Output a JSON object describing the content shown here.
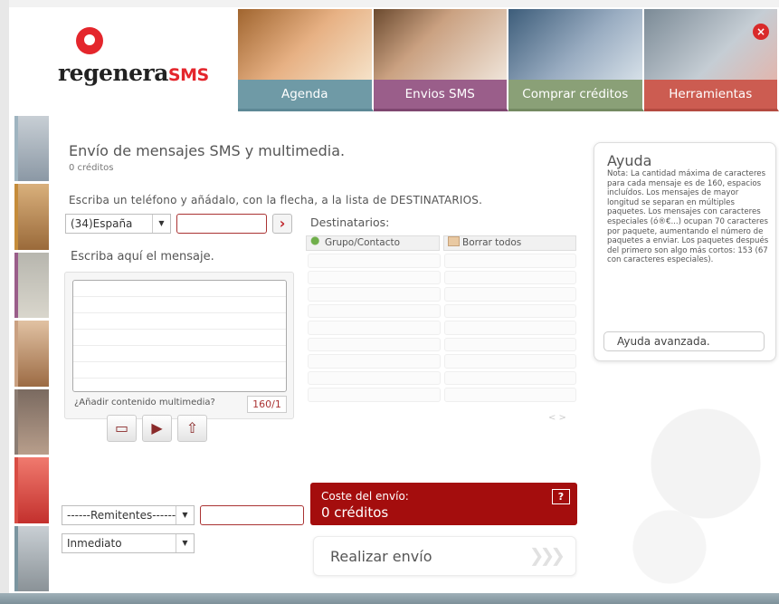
{
  "brand": {
    "logo_main": "regenera",
    "logo_accent": "SMS"
  },
  "nav": {
    "tabs": [
      {
        "label": "Agenda"
      },
      {
        "label": "Envios SMS"
      },
      {
        "label": "Comprar créditos"
      },
      {
        "label": "Herramientas"
      }
    ],
    "close_glyph": "×"
  },
  "main": {
    "title": "Envío de mensajes SMS y multimedia.",
    "credits": "0 créditos",
    "instruction": "Escriba un teléfono y añádalo, con la flecha, a la lista de DESTINATARIOS.",
    "country_select": "(34)España",
    "add_arrow": "›",
    "message_label": "Escriba aquí el mensaje.",
    "multimedia_link": "¿Añadir contenido multimedia?",
    "counter": "160/1",
    "multimedia_buttons": [
      {
        "icon": "image-icon",
        "glyph": "▭"
      },
      {
        "icon": "video-icon",
        "glyph": "▶"
      },
      {
        "icon": "upload-icon",
        "glyph": "⇧"
      }
    ]
  },
  "recipients": {
    "label": "Destinatarios:",
    "add_contact": "Grupo/Contacto",
    "clear_all": "Borrar todos",
    "rows": 9,
    "pager": "< >"
  },
  "send_options": {
    "sender_select": "------Remitentes------",
    "timing_select": "Inmediato"
  },
  "cost": {
    "label": "Coste del envío:",
    "value": "0 créditos",
    "help": "?"
  },
  "send_button": {
    "label": "Realizar envío",
    "arrows": "❯❯❯"
  },
  "help": {
    "title": "Ayuda",
    "text": "Nota: La cantidad máxima de caracteres para cada mensaje es de 160, espacios incluídos. Los mensajes de mayor longitud se separan en múltiples paquetes. Los mensajes con caracteres especiales (ó®€...) ocupan 70 caracteres por paquete, aumentando el número de paquetes a enviar. Los paquetes después del primero son algo más cortos: 153 (67 con caracteres especiales).",
    "advanced": "Ayuda avanzada."
  },
  "colors": {
    "brand_red": "#e4262c",
    "cost_red": "#a40d0d",
    "tab_agenda": "#6f9aa6",
    "tab_envios": "#9a5e8a",
    "tab_comprar": "#8aa077",
    "tab_herramientas": "#cc5c51"
  }
}
